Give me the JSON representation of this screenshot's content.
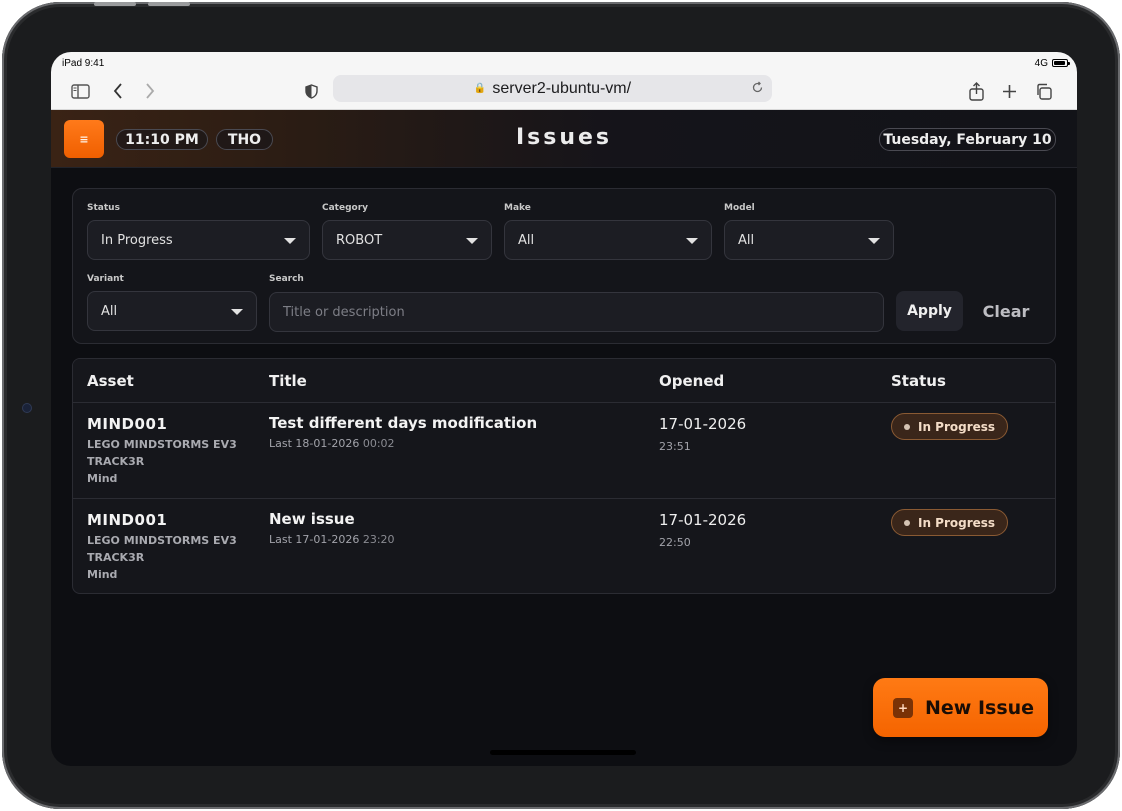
{
  "device": {
    "time": "iPad 9:41",
    "network": "4G"
  },
  "browser": {
    "url": "server2-ubuntu-vm/"
  },
  "header": {
    "menu_icon": "≡",
    "clock": "11:10 PM",
    "user": "THO",
    "title": "Issues",
    "date": "Tuesday, February 10"
  },
  "filters": {
    "status": {
      "label": "Status",
      "value": "In Progress"
    },
    "category": {
      "label": "Category",
      "value": "ROBOT"
    },
    "make": {
      "label": "Make",
      "value": "All"
    },
    "model": {
      "label": "Model",
      "value": "All"
    },
    "variant": {
      "label": "Variant",
      "value": "All"
    },
    "search": {
      "label": "Search",
      "placeholder": "Title or description"
    },
    "apply_label": "Apply",
    "clear_label": "Clear"
  },
  "table": {
    "columns": [
      "Asset",
      "Title",
      "Opened",
      "Status"
    ],
    "rows": [
      {
        "asset_id": "MIND001",
        "asset_line1": "LEGO MINDSTORMS EV3",
        "asset_line2": "TRACK3R",
        "asset_line3": "Mind",
        "title": "Test different days modification",
        "last_prefix": "Last 18-01-2026",
        "last_time": "00:02",
        "opened_date": "17-01-2026",
        "opened_time": "23:51",
        "status": "In Progress"
      },
      {
        "asset_id": "MIND001",
        "asset_line1": "LEGO MINDSTORMS EV3",
        "asset_line2": "TRACK3R",
        "asset_line3": "Mind",
        "title": "New issue",
        "last_prefix": "Last 17-01-2026",
        "last_time": "23:20",
        "opened_date": "17-01-2026",
        "opened_time": "22:50",
        "status": "In Progress"
      }
    ]
  },
  "fab": {
    "icon": "+",
    "label": "New Issue"
  },
  "colors": {
    "accent": "#f46400",
    "background": "#0d0e12",
    "badge_border": "#8a5a33"
  }
}
